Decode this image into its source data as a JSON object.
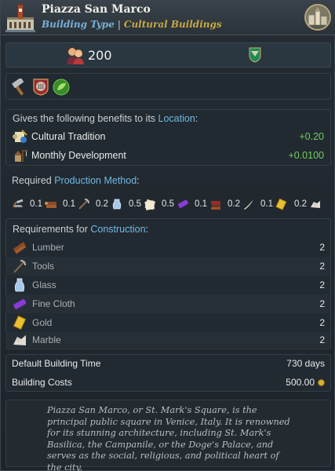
{
  "header": {
    "title": "Piazza San Marco",
    "type_label": "Building Type",
    "separator": "|",
    "type_value": "Cultural Buildings",
    "icon": "venice-building-icon",
    "avatar_icon": "location-portrait-icon"
  },
  "stats": {
    "population_icon": "population-icon",
    "population": "200",
    "shield_icon": "heraldic-shield-icon"
  },
  "traits": [
    {
      "icon": "hammer-icon"
    },
    {
      "icon": "tier-iii-badge-icon"
    },
    {
      "icon": "green-leaf-emblem-icon"
    }
  ],
  "benefits": {
    "label_prefix": "Gives the following benefits to its",
    "label_link": "Location",
    "label_suffix": ":",
    "items": [
      {
        "label": "Cultural Tradition",
        "value": "+0.20",
        "icon": "scroll-tradition-icon"
      },
      {
        "label": "Monthly Development",
        "value": "+0.0100",
        "icon": "development-icon"
      }
    ]
  },
  "production": {
    "label_prefix": "Required",
    "label_link": "Production Method",
    "label_suffix": ":",
    "lead_icon": "hammer-anvil-icon",
    "items": [
      {
        "amount": "0.1",
        "icon": "lumber-icon"
      },
      {
        "amount": "0.1",
        "icon": "tools-icon"
      },
      {
        "amount": "0.2",
        "icon": "glass-icon"
      },
      {
        "amount": "0.5",
        "icon": "paper-icon"
      },
      {
        "amount": "0.5",
        "icon": "fine-cloth-icon"
      },
      {
        "amount": "0.1",
        "icon": "books-icon"
      },
      {
        "amount": "0.2",
        "icon": "ivory-icon"
      },
      {
        "amount": "0.1",
        "icon": "gold-icon"
      },
      {
        "amount": "0.2",
        "icon": "marble-icon"
      }
    ]
  },
  "construction": {
    "label_prefix": "Requirements for",
    "label_link": "Construction",
    "label_suffix": ":",
    "items": [
      {
        "label": "Lumber",
        "value": "2",
        "icon": "lumber-icon"
      },
      {
        "label": "Tools",
        "value": "2",
        "icon": "tools-icon"
      },
      {
        "label": "Glass",
        "value": "2",
        "icon": "glass-icon"
      },
      {
        "label": "Fine Cloth",
        "value": "2",
        "icon": "fine-cloth-icon"
      },
      {
        "label": "Gold",
        "value": "2",
        "icon": "gold-icon"
      },
      {
        "label": "Marble",
        "value": "2",
        "icon": "marble-icon"
      }
    ]
  },
  "costs": {
    "time_label": "Default Building Time",
    "time_value": "730 days",
    "cost_label": "Building Costs",
    "cost_value": "500.00",
    "cost_icon": "gold-coin-icon"
  },
  "description": "Piazza San Marco, or St. Mark's Square, is the principal public square in Venice, Italy. It is renowned for its stunning architecture, including St. Mark's Basilica, the Campanile, or the Doge's Palace, and serves as the social, religious, and political heart of the city.",
  "colors": {
    "accent_gold": "#c8a844",
    "link_blue": "#70b8e4",
    "positive_green": "#6fcf5a"
  }
}
